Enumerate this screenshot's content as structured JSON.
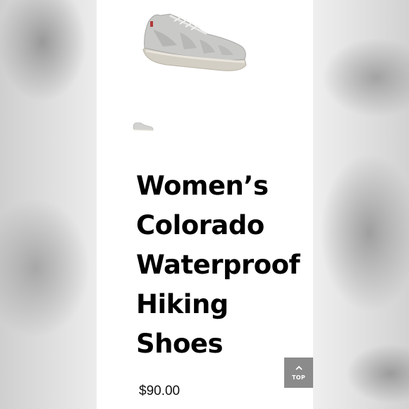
{
  "product": {
    "title_lines": [
      "Women’s",
      "Colorado",
      "Waterproof",
      "Hiking",
      "Shoes"
    ],
    "price": "$90.00",
    "image_icon": "hiking-shoe-image",
    "thumbnail_icon": "hiking-shoe-thumbnail"
  },
  "back_to_top": {
    "label": "TOP",
    "icon": "chevron-up-icon"
  },
  "colors": {
    "page_bg": "#ffffff",
    "text": "#000000",
    "top_button_bg": "#8b8b8b"
  }
}
